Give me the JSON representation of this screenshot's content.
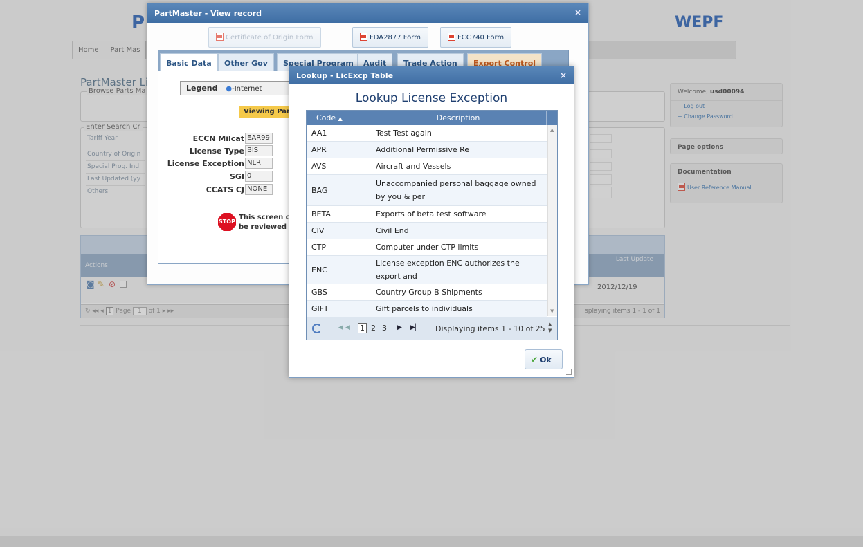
{
  "background": {
    "logo_left": "P",
    "logo_right": "WEPF",
    "nav": [
      "Home",
      "Part Mas"
    ],
    "page_title": "PartMaster Li",
    "browse_legend": "Browse Parts Ma",
    "search_legend": "Enter Search Cr",
    "search_fields": [
      "Tariff Year",
      "Country of Origin",
      "Special Prog. Ind",
      "Last Updated (yy",
      "Others"
    ],
    "sidebar": {
      "welcome_prefix": "Welcome, ",
      "username": "usd00094",
      "log_out": "+ Log out",
      "change_password": "+ Change Password",
      "page_options": "Page options",
      "documentation": "Documentation",
      "user_manual": "User Reference Manual"
    },
    "grid": {
      "actions_header": "Actions",
      "last_update_header": "Last Update",
      "row_date": "2012/12/19",
      "pager_page": "1",
      "pager_label_page": "Page",
      "pager_value": "1",
      "pager_of": "of 1",
      "pager_display": "splaying items 1 - 1 of 1"
    }
  },
  "partmaster_dialog": {
    "title": "PartMaster - View record",
    "close": "×",
    "form_buttons": [
      {
        "label": "Certificate of Origin Form",
        "disabled": true
      },
      {
        "label": "FDA2877 Form",
        "disabled": false
      },
      {
        "label": "FCC740 Form",
        "disabled": false
      }
    ],
    "tabs": [
      "Basic Data",
      "Other Gov",
      "Special Program",
      "Audit",
      "Trade Action",
      "Export Control"
    ],
    "legend_label": "Legend",
    "legend_item": "-Internet",
    "viewing_banner": "Viewing Part M",
    "fields": [
      {
        "label": "ECCN Milcat",
        "value": "EAR99"
      },
      {
        "label": "License Type",
        "value": "BIS"
      },
      {
        "label": "License Exception",
        "value": "NLR"
      },
      {
        "label": "SGI",
        "value": "0"
      },
      {
        "label": "CCATS CJ",
        "value": "NONE"
      }
    ],
    "stop_icon_text": "STOP",
    "stop_line1": "This screen contai",
    "stop_line2": "be reviewed by lo"
  },
  "lookup_dialog": {
    "title": "Lookup - LicExcp Table",
    "close": "×",
    "heading": "Lookup License Exception",
    "columns": {
      "code": "Code",
      "description": "Description"
    },
    "rows": [
      {
        "code": "AA1",
        "description": "Test Test again"
      },
      {
        "code": "APR",
        "description": "Additional Permissive Re"
      },
      {
        "code": "AVS",
        "description": "Aircraft and Vessels"
      },
      {
        "code": "BAG",
        "description": "Unaccompanied personal baggage owned by you & per"
      },
      {
        "code": "BETA",
        "description": "Exports of beta test software"
      },
      {
        "code": "CIV",
        "description": "Civil End"
      },
      {
        "code": "CTP",
        "description": "Computer under CTP limits"
      },
      {
        "code": "ENC",
        "description": "License exception ENC authorizes the export and"
      },
      {
        "code": "GBS",
        "description": "Country Group B Shipments"
      },
      {
        "code": "GIFT",
        "description": "Gift parcels to individuals"
      }
    ],
    "pager": {
      "pages": [
        "1",
        "2",
        "3"
      ],
      "current_page": "1",
      "display": "Displaying items 1 - 10 of 25"
    },
    "ok_label": "Ok"
  },
  "colors": {
    "title_bar": "#4a78ae",
    "grid_header": "#5a82b3",
    "accent_text": "#1f3f70",
    "export_tab": "#c05a1f",
    "stop": "#dd1122"
  }
}
